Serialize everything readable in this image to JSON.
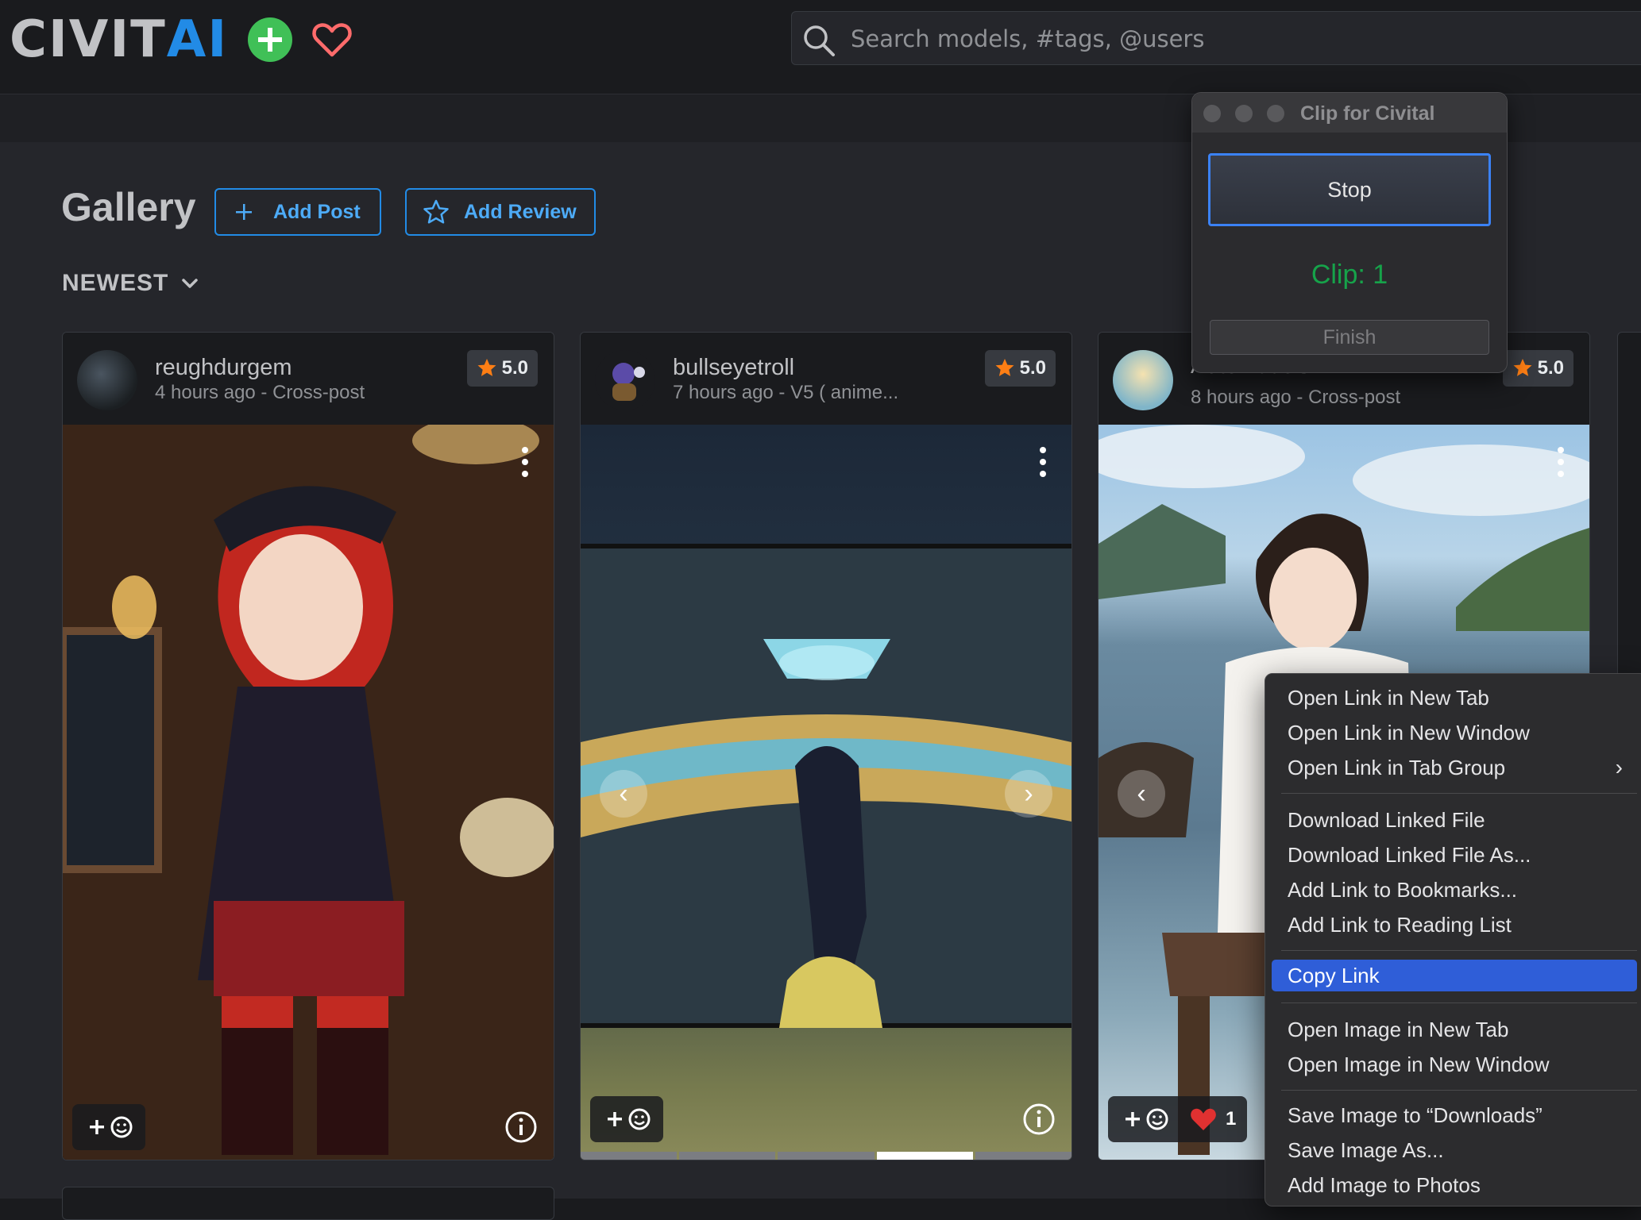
{
  "header": {
    "logo_civ": "CIVIT",
    "logo_ai": "AI",
    "search_placeholder": "Search models, #tags, @users"
  },
  "page": {
    "title": "Gallery",
    "add_post_label": "Add Post",
    "add_review_label": "Add Review",
    "sort_label": "NEWEST"
  },
  "cards": [
    {
      "username": "reughdurgem",
      "meta": "4 hours ago - Cross-post",
      "rating": "5.0"
    },
    {
      "username": "bullseyetroll",
      "meta": "7 hours ago - V5 ( anime...",
      "rating": "5.0"
    },
    {
      "username": "Automaticism",
      "meta": "8 hours ago - Cross-post",
      "rating": "5.0",
      "likes": "1"
    }
  ],
  "clip_window": {
    "title": "Clip for Civital",
    "stop_label": "Stop",
    "count_text": "Clip: 1",
    "finish_label": "Finish"
  },
  "context_menu": {
    "items": [
      "Open Link in New Tab",
      "Open Link in New Window",
      "Open Link in Tab Group",
      "Download Linked File",
      "Download Linked File As...",
      "Add Link to Bookmarks...",
      "Add Link to Reading List",
      "Copy Link",
      "Open Image in New Tab",
      "Open Image in New Window",
      "Save Image to “Downloads”",
      "Save Image As...",
      "Add Image to Photos"
    ],
    "highlighted": "Copy Link"
  },
  "colors": {
    "accent": "#228be6",
    "brand_ai": "#228be6",
    "add_green": "#40c057",
    "heart": "#ff6b6b",
    "star": "#fd7e14",
    "clip_green": "#16a34a",
    "menu_highlight": "#2f5ed8"
  },
  "icons": [
    "plus-circle-icon",
    "heart-icon",
    "search-icon",
    "plus-icon",
    "star-outline-icon",
    "chevron-down-icon",
    "star-icon",
    "more-vertical-icon",
    "add-reaction-icon",
    "info-icon",
    "chevron-left-icon",
    "chevron-right-icon",
    "red-heart-icon"
  ]
}
